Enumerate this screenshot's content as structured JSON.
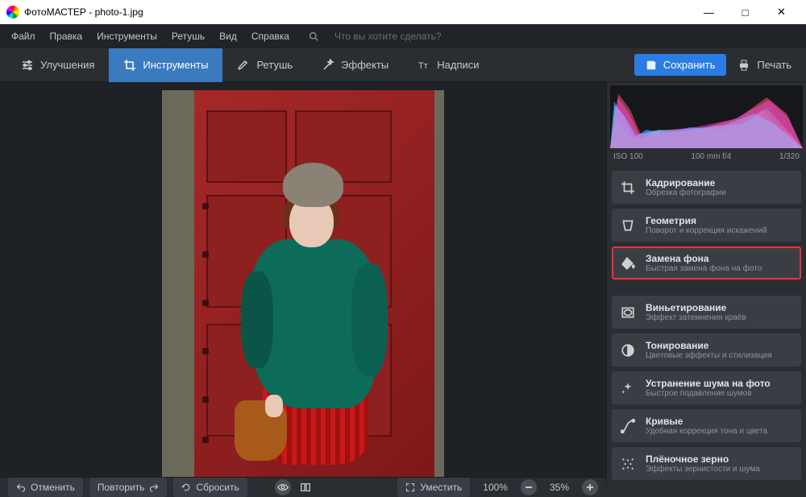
{
  "window": {
    "title": "ФотоМАСТЕР - photo-1.jpg",
    "minimize": "—",
    "maximize": "□",
    "close": "✕"
  },
  "menubar": {
    "items": [
      "Файл",
      "Правка",
      "Инструменты",
      "Ретушь",
      "Вид",
      "Справка"
    ],
    "search_placeholder": "Что вы хотите сделать?"
  },
  "tabs": {
    "enhance": "Улучшения",
    "tools": "Инструменты",
    "retouch": "Ретушь",
    "effects": "Эффекты",
    "captions": "Надписи"
  },
  "topright": {
    "save": "Сохранить",
    "print": "Печать"
  },
  "histogram_info": {
    "iso": "ISO 100",
    "lens": "100 mm f/4",
    "shutter": "1/320"
  },
  "tools": [
    {
      "title": "Кадрирование",
      "desc": "Обрезка фотографии"
    },
    {
      "title": "Геометрия",
      "desc": "Поворот и коррекция искажений"
    },
    {
      "title": "Замена фона",
      "desc": "Быстрая замена фона на фото"
    },
    {
      "title": "Виньетирование",
      "desc": "Эффект затемнения краёв"
    },
    {
      "title": "Тонирование",
      "desc": "Цветовые эффекты и стилизация"
    },
    {
      "title": "Устранение шума на фото",
      "desc": "Быстрое подавление шумов"
    },
    {
      "title": "Кривые",
      "desc": "Удобная коррекция тона и цвета"
    },
    {
      "title": "Плёночное зерно",
      "desc": "Эффекты зернистости и шума"
    }
  ],
  "bottom": {
    "undo": "Отменить",
    "redo": "Повторить",
    "reset": "Сбросить",
    "fit": "Уместить",
    "zoom_fit": "100%",
    "zoom_value": "35%"
  }
}
